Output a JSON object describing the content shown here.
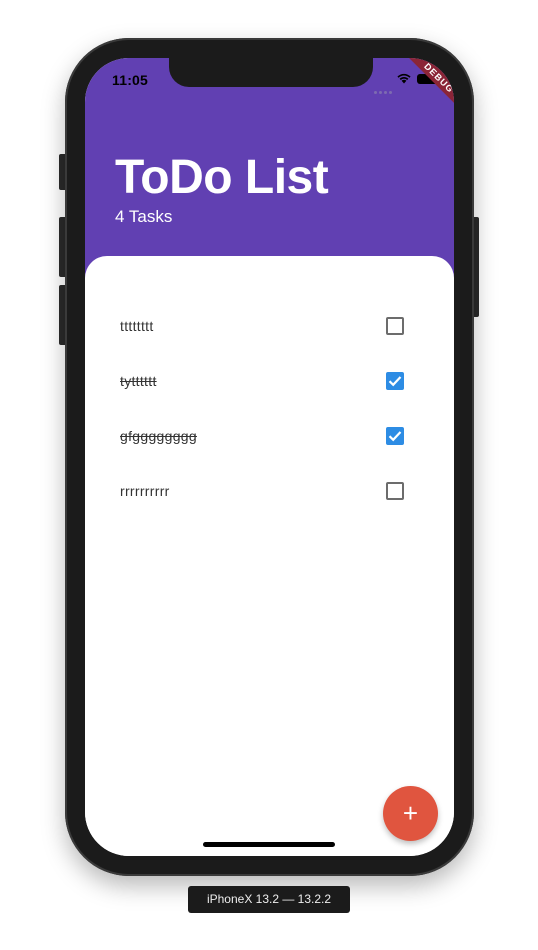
{
  "status_bar": {
    "time": "11:05",
    "icons": [
      "signal-icon",
      "wifi-icon",
      "battery-icon"
    ]
  },
  "debug_banner": "DEBUG",
  "header": {
    "title": "ToDo List",
    "task_count": "4 Tasks",
    "background_color": "#6140b2"
  },
  "tasks": [
    {
      "text": "tttttttt",
      "done": false
    },
    {
      "text": "tytttttt",
      "done": true
    },
    {
      "text": "gfgggggggg",
      "done": true
    },
    {
      "text": "rrrrrrrrrr",
      "done": false
    }
  ],
  "fab": {
    "icon": "plus-icon",
    "label": "+",
    "color": "#e0553f"
  },
  "checkbox_color": "#2d8ce4",
  "device_label": "iPhoneX 13.2 — 13.2.2"
}
